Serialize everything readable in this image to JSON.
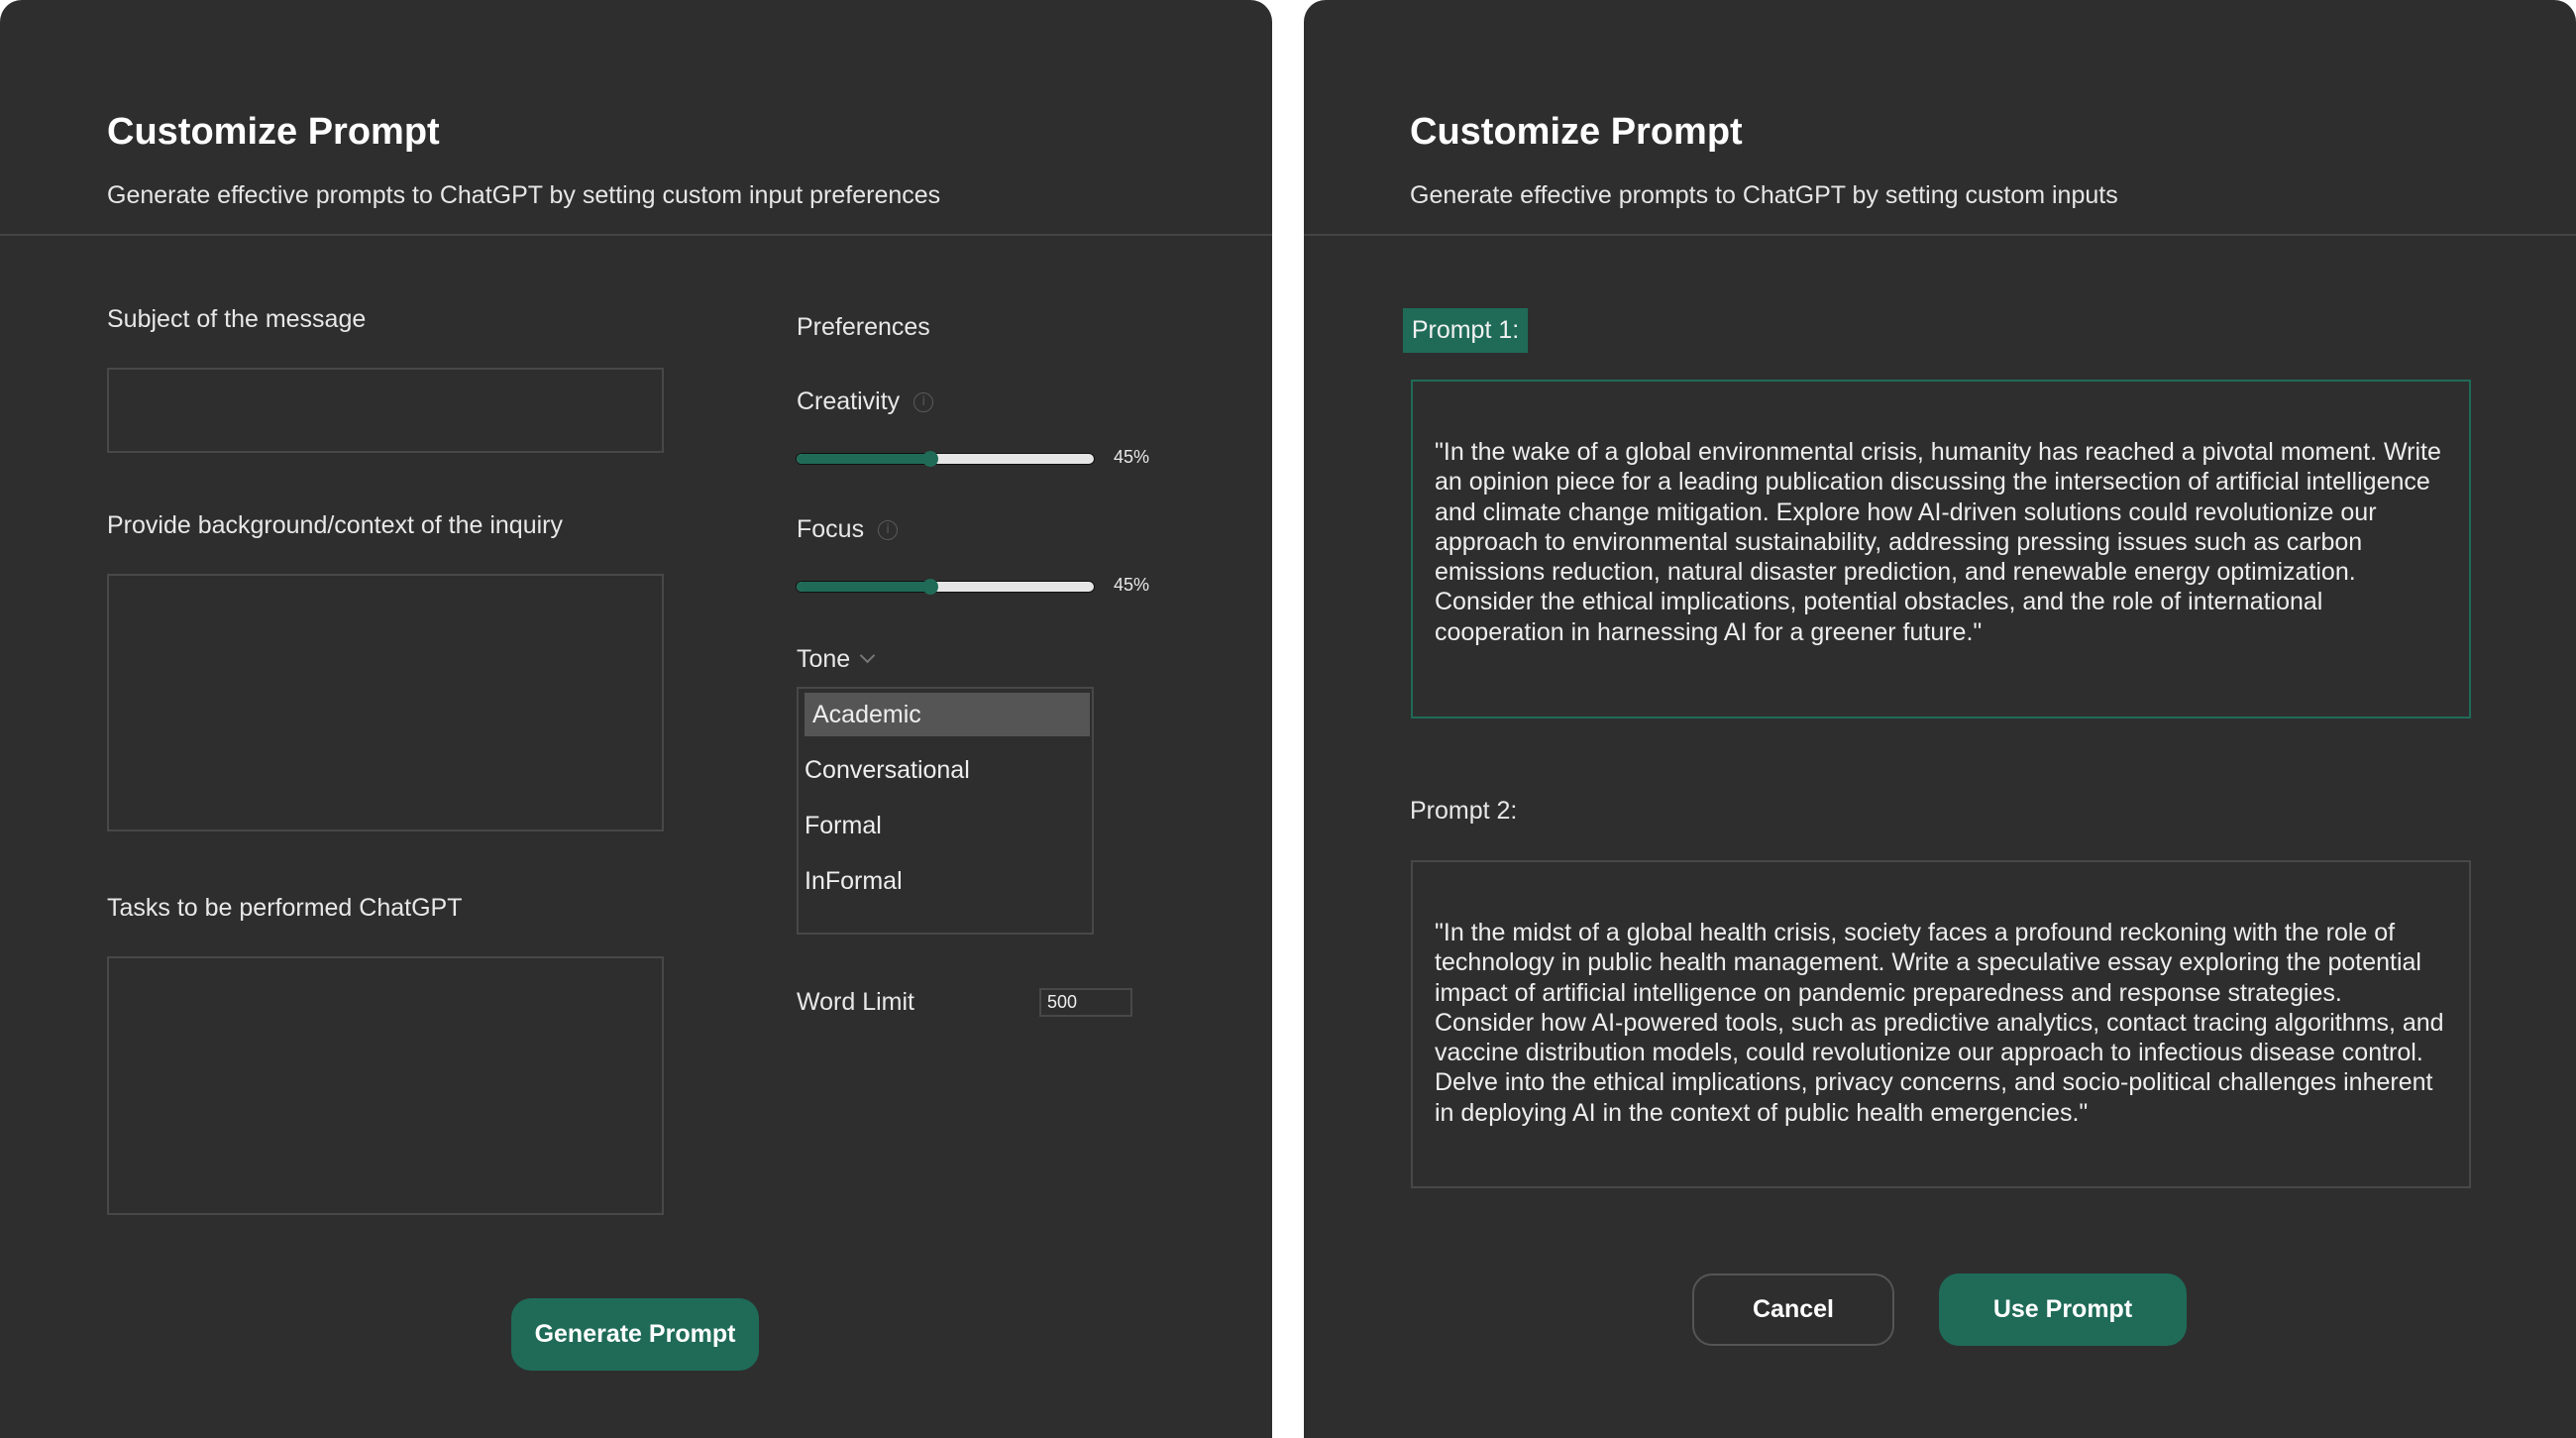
{
  "left_panel": {
    "title": "Customize Prompt",
    "subtitle": "Generate effective prompts to ChatGPT by setting custom input preferences",
    "fields": {
      "subject_label": "Subject of the message",
      "subject_value": "",
      "background_label": "Provide background/context of the inquiry",
      "background_value": "",
      "tasks_label": "Tasks to be performed ChatGPT",
      "tasks_value": ""
    },
    "preferences": {
      "heading": "Preferences",
      "creativity": {
        "label": "Creativity",
        "value_percent": 45,
        "value_label": "45%",
        "info_icon": "info-icon"
      },
      "focus": {
        "label": "Focus",
        "value_percent": 45,
        "value_label": "45%",
        "info_icon": "info-icon"
      },
      "tone": {
        "label": "Tone",
        "selected": "Academic",
        "options": [
          "Academic",
          "Conversational",
          "Formal",
          "InFormal"
        ]
      },
      "word_limit": {
        "label": "Word Limit",
        "value": "500"
      }
    },
    "generate_button": "Generate Prompt"
  },
  "right_panel": {
    "title": "Customize Prompt",
    "subtitle": "Generate effective prompts to ChatGPT by setting custom inputs",
    "prompts": [
      {
        "label": "Prompt 1:",
        "selected": true,
        "text": "\"In the wake of a global environmental crisis, humanity has reached a pivotal moment. Write an opinion piece for a leading publication discussing the intersection of artificial intelligence and climate change mitigation. Explore how AI-driven solutions could revolutionize our approach to environmental sustainability, addressing pressing issues such as carbon emissions reduction, natural disaster prediction, and renewable energy optimization. Consider the ethical implications, potential obstacles, and the role of international cooperation in harnessing AI for a greener future.\""
      },
      {
        "label": "Prompt 2:",
        "selected": false,
        "text": "\"In the midst of a global health crisis, society faces a profound reckoning with the role of technology in public health management. Write a speculative essay exploring the potential impact of artificial intelligence on pandemic preparedness and response strategies. Consider how AI-powered tools, such as predictive analytics, contact tracing algorithms, and vaccine distribution models, could revolutionize our approach to infectious disease control. Delve into the ethical implications, privacy concerns, and socio-political challenges inherent in deploying AI in the context of public health emergencies.\""
      }
    ],
    "cancel_button": "Cancel",
    "use_button": "Use Prompt"
  },
  "colors": {
    "accent": "#1f6b58",
    "panel_bg": "#2e2e2e",
    "page_bg": "#ffffff",
    "border": "#484848",
    "selected_option_bg": "#555555"
  }
}
